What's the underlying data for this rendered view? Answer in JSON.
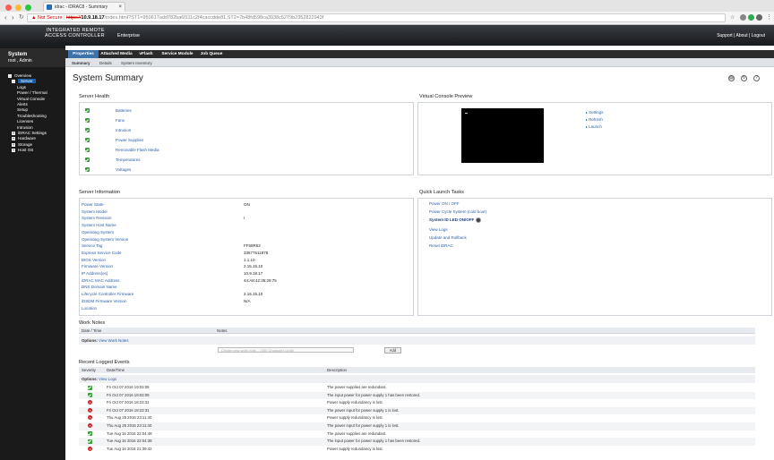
{
  "browser": {
    "tab_title": "idrac - iDRAC8 - Summary",
    "not_secure": "Not Secure",
    "url_scheme": "https://",
    "url_host": "10.9.18.17",
    "url_path": "/index.html?ST1=950617add782ba6f111c2f4caccdde81,ST2=7b48fd598ca3938c5279b2352822943f"
  },
  "banner": {
    "brand_line1": "INTEGRATED REMOTE",
    "brand_line2": "ACCESS CONTROLLER",
    "edition": "Enterprise",
    "links": [
      "Support",
      "|",
      "About",
      "|",
      "Logout"
    ]
  },
  "sidebar": {
    "title": "System",
    "user": "root , Admin",
    "tree": [
      {
        "label": "Overview",
        "level": 0,
        "box": "-"
      },
      {
        "label": "Server",
        "level": 1,
        "box": "-",
        "selected": true
      },
      {
        "label": "Logs",
        "level": 2
      },
      {
        "label": "Power / Thermal",
        "level": 2
      },
      {
        "label": "Virtual Console",
        "level": 2
      },
      {
        "label": "Alerts",
        "level": 2
      },
      {
        "label": "Setup",
        "level": 2
      },
      {
        "label": "Troubleshooting",
        "level": 2
      },
      {
        "label": "Licenses",
        "level": 2
      },
      {
        "label": "Intrusion",
        "level": 2
      },
      {
        "label": "iDRAC Settings",
        "level": 1,
        "box": "+"
      },
      {
        "label": "Hardware",
        "level": 1,
        "box": "+"
      },
      {
        "label": "Storage",
        "level": 1,
        "box": "+"
      },
      {
        "label": "Host OS",
        "level": 1,
        "box": "+"
      }
    ]
  },
  "tabs": [
    "Properties",
    "Attached Media",
    "vFlash",
    "Service Module",
    "Job Queue"
  ],
  "subtabs": [
    "Summary",
    "Details",
    "System Inventory"
  ],
  "page_title": "System Summary",
  "icons": [
    "print-icon",
    "refresh-icon",
    "help-icon"
  ],
  "server_health": {
    "title": "Server Health",
    "items": [
      "Batteries",
      "Fans",
      "Intrusion",
      "Power Supplies",
      "Removable Flash Media",
      "Temperatures",
      "Voltages"
    ]
  },
  "virtual_console": {
    "title": "Virtual Console Preview",
    "links": [
      "Settings",
      "Refresh",
      "Launch"
    ]
  },
  "server_info": {
    "title": "Server Information",
    "rows": [
      {
        "label": "Power State",
        "value": "ON"
      },
      {
        "label": "System Model",
        "value": ""
      },
      {
        "label": "System Revision",
        "value": "I"
      },
      {
        "label": "System Host Name",
        "value": ""
      },
      {
        "label": "Operating System",
        "value": ""
      },
      {
        "label": "Operating System Version",
        "value": ""
      },
      {
        "label": "Service Tag",
        "value": "FF59R52"
      },
      {
        "label": "Express Service Code",
        "value": "33577611878"
      },
      {
        "label": "BIOS Version",
        "value": "1.1.10"
      },
      {
        "label": "Firmware Version",
        "value": "2.15.15.10"
      },
      {
        "label": "IP Address(es)",
        "value": "10.9.18.17"
      },
      {
        "label": "iDRAC MAC Address",
        "value": "44:A8:42:35:29:75"
      },
      {
        "label": "DNS Domain Name",
        "value": ""
      },
      {
        "label": "Lifecycle Controller Firmware",
        "value": "2.15.15.10"
      },
      {
        "label": "iDSDM Firmware Version",
        "value": "N/A"
      },
      {
        "label": "Location",
        "value": ""
      }
    ]
  },
  "quick_launch": {
    "title": "Quick Launch Tasks",
    "links": [
      "Power ON / OFF",
      "Power Cycle System (cold boot)",
      "System ID LED ON/OFF",
      "View Logs",
      "Update and Rollback",
      "Reset iDRAC"
    ]
  },
  "work_notes": {
    "title": "Work Notes",
    "col_date": "Date / Time",
    "col_notes": "Notes",
    "options_label": "Options:",
    "options_link": "View Work Notes",
    "placeholder": "Create new work note... (255 Character Limit)",
    "add_button": "Add"
  },
  "events": {
    "title": "Recent Logged Events",
    "col_severity": "Severity",
    "col_date": "Date/Time",
    "col_desc": "Description",
    "options_label": "Options:",
    "options_link": "View Logs",
    "rows": [
      {
        "severity": "ok",
        "date": "Fri Oct 07 2016 19:03:08",
        "desc": "The power supplies are redundant."
      },
      {
        "severity": "ok",
        "date": "Fri Oct 07 2016 19:03:09",
        "desc": "The input power for power supply 1 has been restored."
      },
      {
        "severity": "error",
        "date": "Fri Oct 07 2016 18:23:31",
        "desc": "Power supply redundancy is lost."
      },
      {
        "severity": "error",
        "date": "Fri Oct 07 2016 18:23:31",
        "desc": "The power input for power supply 1 is lost."
      },
      {
        "severity": "error",
        "date": "Thu Aug 25 2016 23:11:40",
        "desc": "Power supply redundancy is lost."
      },
      {
        "severity": "error",
        "date": "Thu Aug 25 2016 23:11:40",
        "desc": "The power input for power supply 1 is lost."
      },
      {
        "severity": "ok",
        "date": "Tue Aug 16 2016 22:04:48",
        "desc": "The power supplies are redundant."
      },
      {
        "severity": "ok",
        "date": "Tue Aug 16 2016 22:04:38",
        "desc": "The input power for power supply 1 has been restored."
      },
      {
        "severity": "error",
        "date": "Tue Aug 16 2016 21:39:42",
        "desc": "Power supply redundancy is lost."
      }
    ]
  },
  "colors": {
    "accent": "#3e72a8",
    "link": "#2a5fa8",
    "ok": "#3a9e3a",
    "error": "#c62828"
  }
}
